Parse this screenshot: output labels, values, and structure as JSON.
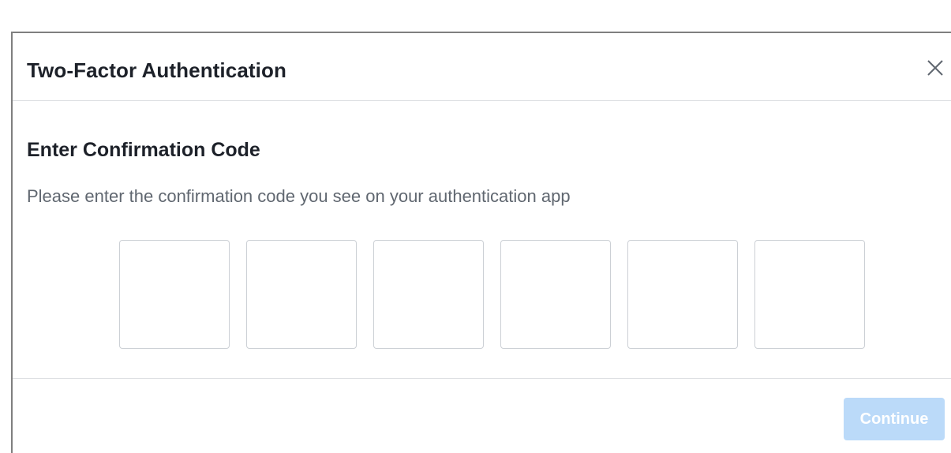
{
  "dialog": {
    "title": "Two-Factor Authentication",
    "close_icon": "close-icon"
  },
  "content": {
    "heading": "Enter Confirmation Code",
    "instructions": "Please enter the confirmation code you see on your authentication app",
    "code_digits": [
      "",
      "",
      "",
      "",
      "",
      ""
    ]
  },
  "footer": {
    "continue_label": "Continue",
    "continue_disabled": true
  },
  "colors": {
    "title_text": "#1d2129",
    "secondary_text": "#606770",
    "divider": "#dddfe2",
    "input_border": "#ccd0d5",
    "button_disabled_bg": "#bbdaf9"
  }
}
